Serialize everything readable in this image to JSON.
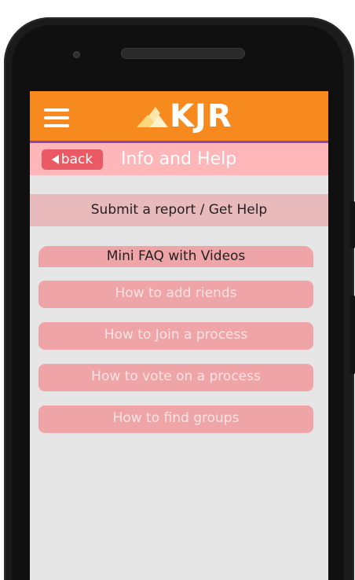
{
  "app": {
    "logo_text": "KJR",
    "brand_color": "#f68a1f",
    "accent_line_color": "#8e44ad"
  },
  "subbar": {
    "back_label": "back",
    "title": "Info and Help"
  },
  "report": {
    "label": "Submit a report / Get Help"
  },
  "faq": {
    "header": "Mini FAQ with Videos",
    "items": [
      {
        "label": "How to add riends"
      },
      {
        "label": "How to Join a process"
      },
      {
        "label": "How to vote on a process"
      },
      {
        "label": "How to find groups"
      }
    ]
  },
  "icons": {
    "menu": "hamburger-menu-icon",
    "back": "triangle-left-icon",
    "logo": "mountain-logo-icon"
  }
}
